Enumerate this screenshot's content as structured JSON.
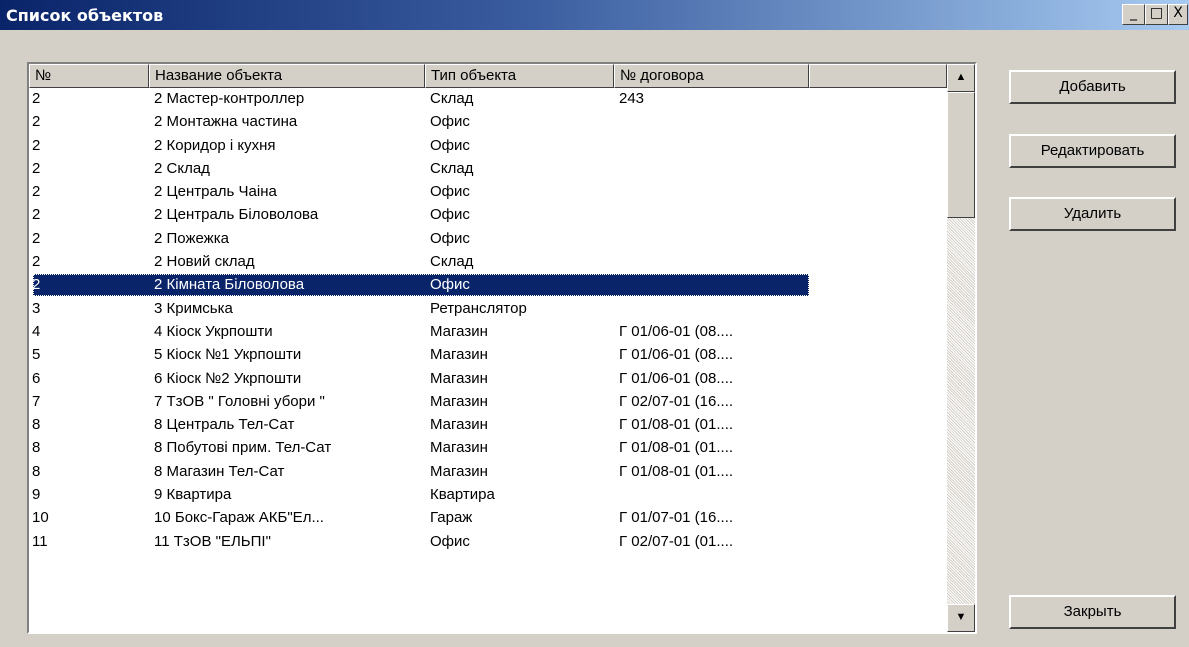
{
  "window": {
    "title": "Список объектов",
    "controls": {
      "minimize": "_",
      "maximize": "□",
      "close": "X"
    }
  },
  "list": {
    "columns": [
      "№",
      "Название объекта",
      "Тип объекта",
      "№ договора",
      ""
    ],
    "rows": [
      {
        "num": "2",
        "name": "2 Мастер-контроллер",
        "type": "Склад",
        "contract": "243"
      },
      {
        "num": "2",
        "name": "2 Монтажна частина",
        "type": "Офис",
        "contract": ""
      },
      {
        "num": "2",
        "name": "2 Коридор і кухня",
        "type": "Офис",
        "contract": ""
      },
      {
        "num": "2",
        "name": "2 Склад",
        "type": "Склад",
        "contract": ""
      },
      {
        "num": "2",
        "name": "2 Централь Чаіна",
        "type": "Офис",
        "contract": ""
      },
      {
        "num": "2",
        "name": "2 Централь Біловолова",
        "type": "Офис",
        "contract": ""
      },
      {
        "num": "2",
        "name": "2 Пожежка",
        "type": "Офис",
        "contract": ""
      },
      {
        "num": "2",
        "name": "2 Новий склад",
        "type": "Склад",
        "contract": ""
      },
      {
        "num": "2",
        "name": "2 Кімната Біловолова",
        "type": "Офис",
        "contract": "",
        "selected": true
      },
      {
        "num": "3",
        "name": "3 Кримська",
        "type": "Ретранслятор",
        "contract": ""
      },
      {
        "num": "4",
        "name": "4 Кіоск  Укрпошти",
        "type": "Магазин",
        "contract": "Г 01/06-01 (08...."
      },
      {
        "num": "5",
        "name": "5 Кіоск №1  Укрпошти",
        "type": "Магазин",
        "contract": "Г 01/06-01 (08...."
      },
      {
        "num": "6",
        "name": "6 Кіоск №2  Укрпошти",
        "type": "Магазин",
        "contract": "Г 01/06-01 (08...."
      },
      {
        "num": "7",
        "name": "7 ТзОВ \" Головні убори \"",
        "type": "Магазин",
        "contract": "Г 02/07-01 (16...."
      },
      {
        "num": "8",
        "name": "8 Централь Тел-Сат",
        "type": "Магазин",
        "contract": "Г 01/08-01 (01...."
      },
      {
        "num": "8",
        "name": "8 Побутові прим. Тел-Сат",
        "type": "Магазин",
        "contract": "Г 01/08-01 (01...."
      },
      {
        "num": "8",
        "name": "8 Магазин Тел-Сат",
        "type": "Магазин",
        "contract": "Г 01/08-01 (01...."
      },
      {
        "num": "9",
        "name": "9 Квартира",
        "type": "Квартира",
        "contract": ""
      },
      {
        "num": "10",
        "name": "10 Бокс-Гараж АКБ\"Ел...",
        "type": "Гараж",
        "contract": "Г 01/07-01 (16...."
      },
      {
        "num": "11",
        "name": "11 ТзОВ \"ЕЛЬПІ\"",
        "type": "Офис",
        "contract": "Г 02/07-01 (01...."
      }
    ]
  },
  "scrollbar": {
    "up_arrow": "▲",
    "down_arrow": "▼"
  },
  "buttons": {
    "add": "Добавить",
    "edit": "Редактировать",
    "delete": "Удалить",
    "close": "Закрыть"
  }
}
